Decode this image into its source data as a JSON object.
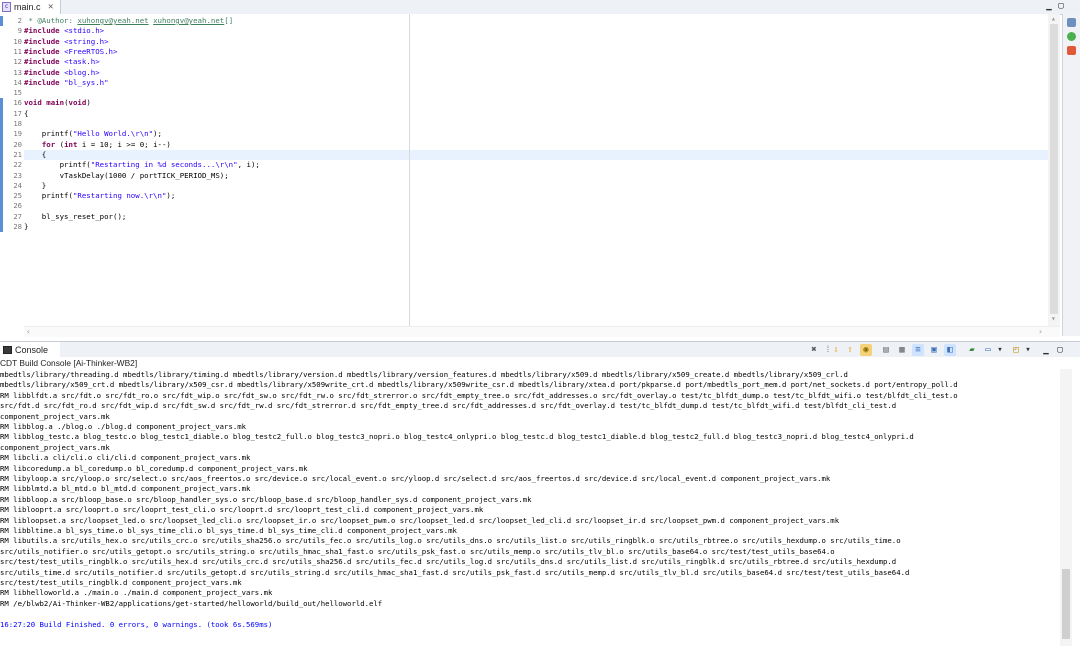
{
  "editor": {
    "tab_label": "main.c",
    "tab_close": "✕",
    "lines": [
      {
        "n": "2",
        "segs": [
          [
            "cmt",
            " * @Author: "
          ],
          [
            "link",
            "xuhongv@yeah.net"
          ],
          [
            "cmt",
            " "
          ],
          [
            "link",
            "xuhongv@yeah.net"
          ],
          [
            "cmt",
            "[]"
          ]
        ]
      },
      {
        "n": "9",
        "segs": [
          [
            "kw",
            "#include"
          ],
          [
            "",
            " "
          ],
          [
            "inc",
            "<stdio.h>"
          ]
        ]
      },
      {
        "n": "10",
        "segs": [
          [
            "kw",
            "#include"
          ],
          [
            "",
            " "
          ],
          [
            "inc",
            "<string.h>"
          ]
        ]
      },
      {
        "n": "11",
        "segs": [
          [
            "kw",
            "#include"
          ],
          [
            "",
            " "
          ],
          [
            "inc",
            "<FreeRTOS.h>"
          ]
        ]
      },
      {
        "n": "12",
        "segs": [
          [
            "kw",
            "#include"
          ],
          [
            "",
            " "
          ],
          [
            "inc",
            "<task.h>"
          ]
        ]
      },
      {
        "n": "13",
        "segs": [
          [
            "kw",
            "#include"
          ],
          [
            "",
            " "
          ],
          [
            "inc",
            "<blog.h>"
          ]
        ]
      },
      {
        "n": "14",
        "segs": [
          [
            "kw",
            "#include"
          ],
          [
            "",
            " "
          ],
          [
            "inc",
            "\"bl_sys.h\""
          ]
        ]
      },
      {
        "n": "15",
        "segs": []
      },
      {
        "n": "16",
        "segs": [
          [
            "kw",
            "void"
          ],
          [
            "",
            " "
          ],
          [
            "kw",
            "main"
          ],
          [
            "",
            "("
          ],
          [
            "kw",
            "void"
          ],
          [
            "",
            ")"
          ]
        ]
      },
      {
        "n": "17",
        "segs": [
          [
            "",
            "{"
          ]
        ]
      },
      {
        "n": "18",
        "segs": []
      },
      {
        "n": "19",
        "segs": [
          [
            "",
            "    printf("
          ],
          [
            "str",
            "\"Hello World.\\r\\n\""
          ],
          [
            "",
            ");"
          ]
        ]
      },
      {
        "n": "20",
        "segs": [
          [
            "",
            "    "
          ],
          [
            "kw",
            "for"
          ],
          [
            "",
            " ("
          ],
          [
            "kw",
            "int"
          ],
          [
            "",
            " i = 10; i >= 0; i--)"
          ]
        ]
      },
      {
        "n": "21",
        "segs": [
          [
            "",
            "    {"
          ]
        ],
        "hl": true
      },
      {
        "n": "22",
        "segs": [
          [
            "",
            "        printf("
          ],
          [
            "str",
            "\"Restarting in %d seconds...\\r\\n\""
          ],
          [
            "",
            ", i);"
          ]
        ]
      },
      {
        "n": "23",
        "segs": [
          [
            "",
            "        vTaskDelay(1000 / portTICK_PERIOD_MS);"
          ]
        ]
      },
      {
        "n": "24",
        "segs": [
          [
            "",
            "    }"
          ]
        ]
      },
      {
        "n": "25",
        "segs": [
          [
            "",
            "    printf("
          ],
          [
            "str",
            "\"Restarting now.\\r\\n\""
          ],
          [
            "",
            ");"
          ]
        ]
      },
      {
        "n": "26",
        "segs": []
      },
      {
        "n": "27",
        "segs": [
          [
            "",
            "    bl_sys_reset_por();"
          ]
        ]
      },
      {
        "n": "28",
        "segs": [
          [
            "",
            "}"
          ]
        ]
      }
    ]
  },
  "console": {
    "tab_label": "Console",
    "title": "CDT Build Console [Ai-Thinker-WB2]",
    "lines": [
      "mbedtls/library/threading.d mbedtls/library/timing.d mbedtls/library/version.d mbedtls/library/version_features.d mbedtls/library/x509.d mbedtls/library/x509_create.d mbedtls/library/x509_crl.d",
      "mbedtls/library/x509_crt.d mbedtls/library/x509_csr.d mbedtls/library/x509write_crt.d mbedtls/library/x509write_csr.d mbedtls/library/xtea.d port/pkparse.d port/mbedtls_port_mem.d port/net_sockets.d port/entropy_poll.d",
      "RM libblfdt.a src/fdt.o src/fdt_ro.o src/fdt_wip.o src/fdt_sw.o src/fdt_rw.o src/fdt_strerror.o src/fdt_empty_tree.o src/fdt_addresses.o src/fdt_overlay.o test/tc_blfdt_dump.o test/tc_blfdt_wifi.o test/blfdt_cli_test.o",
      "src/fdt.d src/fdt_ro.d src/fdt_wip.d src/fdt_sw.d src/fdt_rw.d src/fdt_strerror.d src/fdt_empty_tree.d src/fdt_addresses.d src/fdt_overlay.d test/tc_blfdt_dump.d test/tc_blfdt_wifi.d test/blfdt_cli_test.d",
      "component_project_vars.mk",
      "RM libblog.a ./blog.o ./blog.d component_project_vars.mk",
      "RM libblog_testc.a blog_testc.o blog_testc1_diable.o blog_testc2_full.o blog_testc3_nopri.o blog_testc4_onlypri.o blog_testc.d blog_testc1_diable.d blog_testc2_full.d blog_testc3_nopri.d blog_testc4_onlypri.d",
      "component_project_vars.mk",
      "RM libcli.a cli/cli.o cli/cli.d component_project_vars.mk",
      "RM libcoredump.a bl_coredump.o bl_coredump.d component_project_vars.mk",
      "RM libyloop.a src/yloop.o src/select.o src/aos_freertos.o src/device.o src/local_event.o src/yloop.d src/select.d src/aos_freertos.d src/device.d src/local_event.d component_project_vars.mk",
      "RM libblmtd.a bl_mtd.o bl_mtd.d component_project_vars.mk",
      "RM libbloop.a src/bloop_base.o src/bloop_handler_sys.o src/bloop_base.d src/bloop_handler_sys.d component_project_vars.mk",
      "RM liblooprt.a src/looprt.o src/looprt_test_cli.o src/looprt.d src/looprt_test_cli.d component_project_vars.mk",
      "RM libloopset.a src/loopset_led.o src/loopset_led_cli.o src/loopset_ir.o src/loopset_pwm.o src/loopset_led.d src/loopset_led_cli.d src/loopset_ir.d src/loopset_pwm.d component_project_vars.mk",
      "RM libbltime.a bl_sys_time.o bl_sys_time_cli.o bl_sys_time.d bl_sys_time_cli.d component_project_vars.mk",
      "RM libutils.a src/utils_hex.o src/utils_crc.o src/utils_sha256.o src/utils_fec.o src/utils_log.o src/utils_dns.o src/utils_list.o src/utils_ringblk.o src/utils_rbtree.o src/utils_hexdump.o src/utils_time.o",
      "src/utils_notifier.o src/utils_getopt.o src/utils_string.o src/utils_hmac_sha1_fast.o src/utils_psk_fast.o src/utils_memp.o src/utils_tlv_bl.o src/utils_base64.o src/test/test_utils_base64.o",
      "src/test/test_utils_ringblk.o src/utils_hex.d src/utils_crc.d src/utils_sha256.d src/utils_fec.d src/utils_log.d src/utils_dns.d src/utils_list.d src/utils_ringblk.d src/utils_rbtree.d src/utils_hexdump.d",
      "src/utils_time.d src/utils_notifier.d src/utils_getopt.d src/utils_string.d src/utils_hmac_sha1_fast.d src/utils_psk_fast.d src/utils_memp.d src/utils_tlv_bl.d src/utils_base64.d src/test/test_utils_base64.d",
      "src/test/test_utils_ringblk.d component_project_vars.mk",
      "RM libhelloworld.a ./main.o ./main.d component_project_vars.mk",
      "RM /e/blwb2/Ai-Thinker-WB2/applications/get-started/helloworld/build_out/helloworld.elf",
      "",
      "16:27:20 Build Finished. 0 errors, 0 warnings. (took 6s.569ms)"
    ]
  },
  "colors": {
    "keyword": "#7f0055",
    "string": "#2a00ff",
    "comment": "#3f7f5f",
    "build_finished": "#0000ff",
    "current_line": "#e8f2fe"
  }
}
